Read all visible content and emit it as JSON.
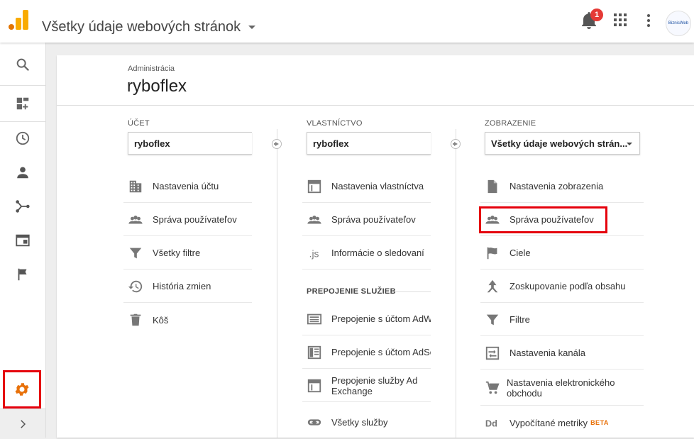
{
  "header": {
    "title": "Všetky údaje webových stránok",
    "notification_count": "1",
    "avatar_text": "BiznisWeb",
    "brand_color": "#f9ab00",
    "accent_color": "#e5000c"
  },
  "leftnav": {
    "items": [
      {
        "icon": "search-icon"
      },
      {
        "icon": "customization-icon"
      },
      {
        "icon": "realtime-clock-icon"
      },
      {
        "icon": "audience-person-icon"
      },
      {
        "icon": "acquisition-icon"
      },
      {
        "icon": "behavior-icon"
      },
      {
        "icon": "conversions-flag-icon"
      },
      {
        "icon": "admin-gear-icon"
      },
      {
        "icon": "expand-chevron-icon"
      }
    ]
  },
  "admin": {
    "breadcrumb": "Administrácia",
    "account_name": "ryboflex"
  },
  "account": {
    "label": "ÚČET",
    "selected": "ryboflex",
    "items": [
      {
        "label": "Nastavenia účtu",
        "icon": "building-icon"
      },
      {
        "label": "Správa používateľov",
        "icon": "people-icon"
      },
      {
        "label": "Všetky filtre",
        "icon": "filter-icon"
      },
      {
        "label": "História zmien",
        "icon": "history-icon"
      },
      {
        "label": "Kôš",
        "icon": "trash-icon"
      }
    ]
  },
  "property": {
    "label": "VLASTNÍCTVO",
    "selected": "ryboflex",
    "items": [
      {
        "label": "Nastavenia vlastníctva",
        "icon": "window-icon"
      },
      {
        "label": "Správa používateľov",
        "icon": "people-icon"
      },
      {
        "label": "Informácie o sledovaní",
        "icon": "js-icon"
      }
    ],
    "section_title": "PREPOJENIE SLUŽIEB",
    "link_items": [
      {
        "label": "Prepojenie s účtom AdWords",
        "icon": "adwords-icon"
      },
      {
        "label": "Prepojenie s účtom AdSense",
        "icon": "adsense-icon"
      },
      {
        "label": "Prepojenie služby Ad Exchange",
        "icon": "window-icon"
      },
      {
        "label": "Všetky služby",
        "icon": "link-icon"
      }
    ]
  },
  "view": {
    "label": "ZOBRAZENIE",
    "selected": "Všetky údaje webových strán...",
    "items": [
      {
        "label": "Nastavenia zobrazenia",
        "icon": "document-icon"
      },
      {
        "label": "Správa používateľov",
        "icon": "people-icon"
      },
      {
        "label": "Ciele",
        "icon": "flag-icon"
      },
      {
        "label": "Zoskupovanie podľa obsahu",
        "icon": "grouping-icon"
      },
      {
        "label": "Filtre",
        "icon": "filter-icon"
      },
      {
        "label": "Nastavenia kanála",
        "icon": "channel-icon"
      },
      {
        "label": "Nastavenia elektronického obchodu",
        "icon": "cart-icon"
      },
      {
        "label": "Vypočítané metriky",
        "icon": "dd-icon",
        "badge": "BETA"
      }
    ]
  }
}
